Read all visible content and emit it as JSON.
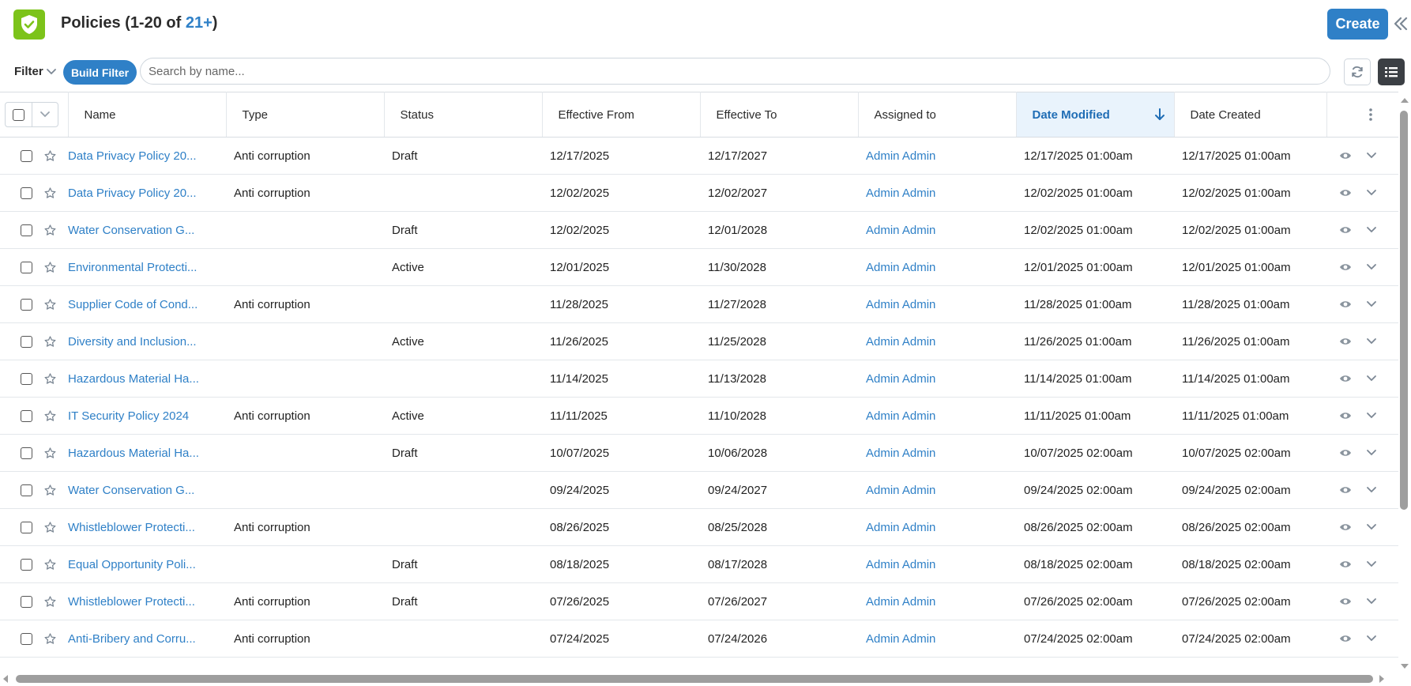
{
  "header": {
    "title_prefix": "Policies (1-20 of ",
    "title_count": "21+",
    "title_suffix": ")",
    "create_label": "Create",
    "app_icon": "shield-check-icon"
  },
  "filterbar": {
    "filter_label": "Filter",
    "build_filter_label": "Build Filter",
    "search_placeholder": "Search by name..."
  },
  "columns": {
    "name": "Name",
    "type": "Type",
    "status": "Status",
    "effective_from": "Effective From",
    "effective_to": "Effective To",
    "assigned_to": "Assigned to",
    "date_modified": "Date Modified",
    "date_created": "Date Created"
  },
  "sort": {
    "column": "date_modified",
    "direction": "descending"
  },
  "rows": [
    {
      "name": "Data Privacy Policy 20...",
      "type": "Anti corruption",
      "status": "Draft",
      "from": "12/17/2025",
      "to": "12/17/2027",
      "assigned": "Admin Admin",
      "modified": "12/17/2025 01:00am",
      "created": "12/17/2025 01:00am"
    },
    {
      "name": "Data Privacy Policy 20...",
      "type": "Anti corruption",
      "status": "",
      "from": "12/02/2025",
      "to": "12/02/2027",
      "assigned": "Admin Admin",
      "modified": "12/02/2025 01:00am",
      "created": "12/02/2025 01:00am"
    },
    {
      "name": "Water Conservation G...",
      "type": "",
      "status": "Draft",
      "from": "12/02/2025",
      "to": "12/01/2028",
      "assigned": "Admin Admin",
      "modified": "12/02/2025 01:00am",
      "created": "12/02/2025 01:00am"
    },
    {
      "name": "Environmental Protecti...",
      "type": "",
      "status": "Active",
      "from": "12/01/2025",
      "to": "11/30/2028",
      "assigned": "Admin Admin",
      "modified": "12/01/2025 01:00am",
      "created": "12/01/2025 01:00am"
    },
    {
      "name": "Supplier Code of Cond...",
      "type": "Anti corruption",
      "status": "",
      "from": "11/28/2025",
      "to": "11/27/2028",
      "assigned": "Admin Admin",
      "modified": "11/28/2025 01:00am",
      "created": "11/28/2025 01:00am"
    },
    {
      "name": "Diversity and Inclusion...",
      "type": "",
      "status": "Active",
      "from": "11/26/2025",
      "to": "11/25/2028",
      "assigned": "Admin Admin",
      "modified": "11/26/2025 01:00am",
      "created": "11/26/2025 01:00am"
    },
    {
      "name": "Hazardous Material Ha...",
      "type": "",
      "status": "",
      "from": "11/14/2025",
      "to": "11/13/2028",
      "assigned": "Admin Admin",
      "modified": "11/14/2025 01:00am",
      "created": "11/14/2025 01:00am"
    },
    {
      "name": "IT Security Policy 2024",
      "type": "Anti corruption",
      "status": "Active",
      "from": "11/11/2025",
      "to": "11/10/2028",
      "assigned": "Admin Admin",
      "modified": "11/11/2025 01:00am",
      "created": "11/11/2025 01:00am"
    },
    {
      "name": "Hazardous Material Ha...",
      "type": "",
      "status": "Draft",
      "from": "10/07/2025",
      "to": "10/06/2028",
      "assigned": "Admin Admin",
      "modified": "10/07/2025 02:00am",
      "created": "10/07/2025 02:00am"
    },
    {
      "name": "Water Conservation G...",
      "type": "",
      "status": "",
      "from": "09/24/2025",
      "to": "09/24/2027",
      "assigned": "Admin Admin",
      "modified": "09/24/2025 02:00am",
      "created": "09/24/2025 02:00am"
    },
    {
      "name": "Whistleblower Protecti...",
      "type": "Anti corruption",
      "status": "",
      "from": "08/26/2025",
      "to": "08/25/2028",
      "assigned": "Admin Admin",
      "modified": "08/26/2025 02:00am",
      "created": "08/26/2025 02:00am"
    },
    {
      "name": "Equal Opportunity Poli...",
      "type": "",
      "status": "Draft",
      "from": "08/18/2025",
      "to": "08/17/2028",
      "assigned": "Admin Admin",
      "modified": "08/18/2025 02:00am",
      "created": "08/18/2025 02:00am"
    },
    {
      "name": "Whistleblower Protecti...",
      "type": "Anti corruption",
      "status": "Draft",
      "from": "07/26/2025",
      "to": "07/26/2027",
      "assigned": "Admin Admin",
      "modified": "07/26/2025 02:00am",
      "created": "07/26/2025 02:00am"
    },
    {
      "name": "Anti-Bribery and Corru...",
      "type": "Anti corruption",
      "status": "",
      "from": "07/24/2025",
      "to": "07/24/2026",
      "assigned": "Admin Admin",
      "modified": "07/24/2025 02:00am",
      "created": "07/24/2025 02:00am"
    }
  ],
  "colors": {
    "accent": "#2f80c7",
    "brand_green": "#7cc31a",
    "sorted_header_bg": "#e9f3fc"
  }
}
